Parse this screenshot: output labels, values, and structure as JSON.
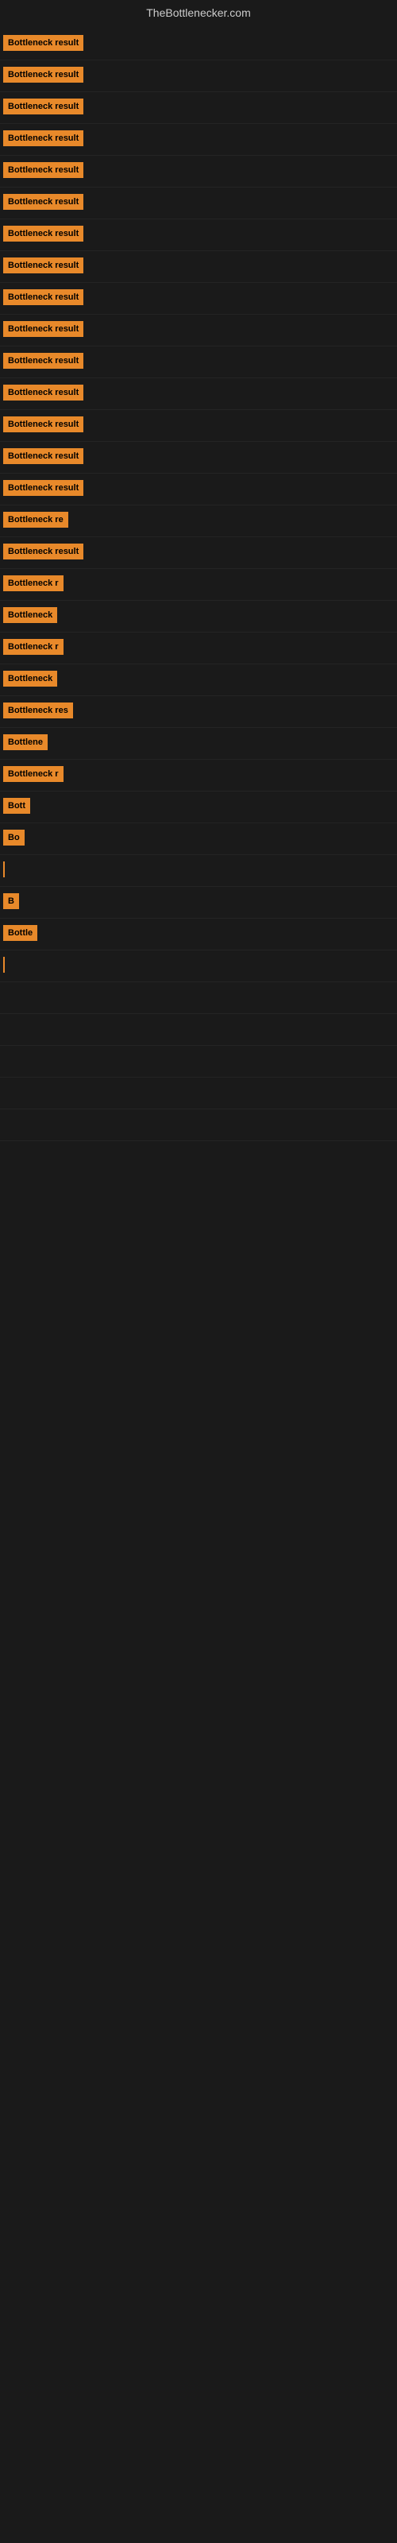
{
  "site": {
    "title": "TheBottlenecker.com"
  },
  "results": [
    {
      "id": 1,
      "label": "Bottleneck result",
      "width": 120
    },
    {
      "id": 2,
      "label": "Bottleneck result",
      "width": 120
    },
    {
      "id": 3,
      "label": "Bottleneck result",
      "width": 120
    },
    {
      "id": 4,
      "label": "Bottleneck result",
      "width": 120
    },
    {
      "id": 5,
      "label": "Bottleneck result",
      "width": 120
    },
    {
      "id": 6,
      "label": "Bottleneck result",
      "width": 120
    },
    {
      "id": 7,
      "label": "Bottleneck result",
      "width": 120
    },
    {
      "id": 8,
      "label": "Bottleneck result",
      "width": 120
    },
    {
      "id": 9,
      "label": "Bottleneck result",
      "width": 115
    },
    {
      "id": 10,
      "label": "Bottleneck result",
      "width": 115
    },
    {
      "id": 11,
      "label": "Bottleneck result",
      "width": 115
    },
    {
      "id": 12,
      "label": "Bottleneck result",
      "width": 112
    },
    {
      "id": 13,
      "label": "Bottleneck result",
      "width": 112
    },
    {
      "id": 14,
      "label": "Bottleneck result",
      "width": 110
    },
    {
      "id": 15,
      "label": "Bottleneck result",
      "width": 108
    },
    {
      "id": 16,
      "label": "Bottleneck re",
      "width": 100
    },
    {
      "id": 17,
      "label": "Bottleneck result",
      "width": 108
    },
    {
      "id": 18,
      "label": "Bottleneck r",
      "width": 90
    },
    {
      "id": 19,
      "label": "Bottleneck",
      "width": 78
    },
    {
      "id": 20,
      "label": "Bottleneck r",
      "width": 88
    },
    {
      "id": 21,
      "label": "Bottleneck",
      "width": 76
    },
    {
      "id": 22,
      "label": "Bottleneck res",
      "width": 96
    },
    {
      "id": 23,
      "label": "Bottlene",
      "width": 70
    },
    {
      "id": 24,
      "label": "Bottleneck r",
      "width": 86
    },
    {
      "id": 25,
      "label": "Bott",
      "width": 42
    },
    {
      "id": 26,
      "label": "Bo",
      "width": 28
    },
    {
      "id": 27,
      "label": "|",
      "width": 8
    },
    {
      "id": 28,
      "label": "B",
      "width": 14
    },
    {
      "id": 29,
      "label": "Bottle",
      "width": 50
    },
    {
      "id": 30,
      "label": "|",
      "width": 8
    },
    {
      "id": 31,
      "label": "",
      "width": 0
    },
    {
      "id": 32,
      "label": "",
      "width": 0
    },
    {
      "id": 33,
      "label": "",
      "width": 0
    },
    {
      "id": 34,
      "label": "",
      "width": 0
    },
    {
      "id": 35,
      "label": "",
      "width": 0
    }
  ]
}
